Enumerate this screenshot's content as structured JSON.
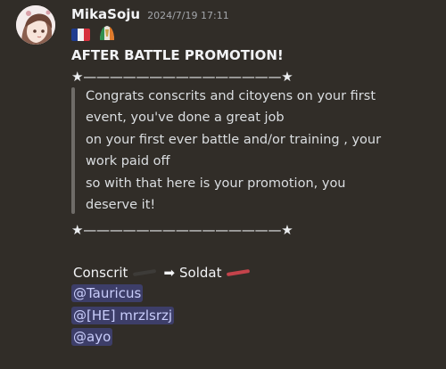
{
  "message": {
    "author": "MikaSoju",
    "timestamp": "2024/7/19 17:11",
    "avatar_icon": "anime-girl-avatar-icon",
    "flags": [
      "france-flag-icon",
      "ireland-flag-icon"
    ],
    "heading": "AFTER BATTLE PROMOTION!",
    "divider": "★———————————————★",
    "quote_lines": [
      "Congrats conscrits and citoyens on your first",
      "event, you've done a great job",
      "on your first ever battle and/or training , your",
      "work paid off",
      "so with that here is your promotion, you",
      "deserve it!"
    ],
    "promotion": {
      "from_rank": "Conscrit",
      "to_rank": "Soldat",
      "from_color": "#3d3b38",
      "to_color": "#c4434b",
      "arrow_icon": "right-arrow-icon"
    },
    "mentions": [
      "@Tauricus",
      "@[HE] mrzlsrzj",
      "@ayo"
    ]
  },
  "colors": {
    "background": "#312d28",
    "mention_text": "#c9cdfb",
    "quote_bar": "#6f6c68"
  }
}
